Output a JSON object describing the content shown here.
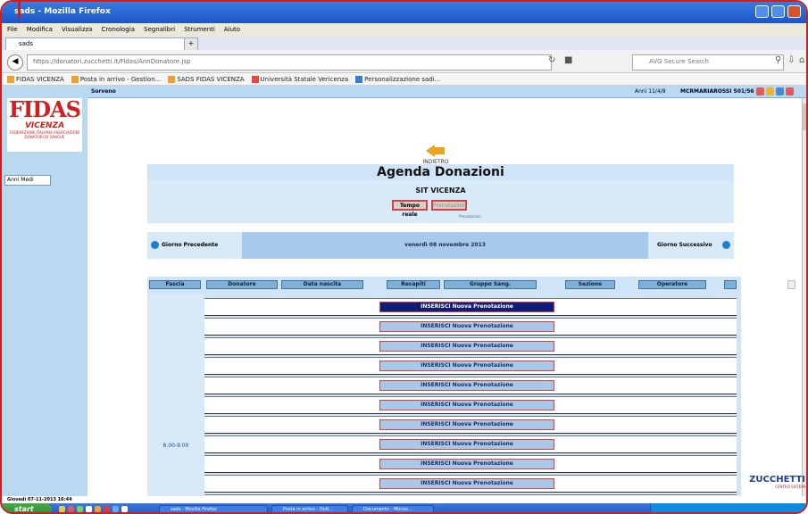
{
  "browser": {
    "title": "sads - Mozilla Firefox",
    "menu": [
      "File",
      "Modifica",
      "Visualizza",
      "Cronologia",
      "Segnalibri",
      "Strumenti",
      "Aiuto"
    ],
    "tab_label": "sads",
    "url": "https://donatori.zucchetti.it/Fidas/AnnDonatore.jsp",
    "search_placeholder": "AVG Secure Search",
    "bookmarks": [
      "FIDAS VICENZA",
      "Posta in arrivo - Gestion...",
      "SADS FIDAS VICENZA",
      "Università Statale Vericenza",
      "Personalizzazione sadi..."
    ]
  },
  "app": {
    "sidebar": {
      "logo_text": "FIDAS",
      "logo_sub": "VICENZA",
      "logo_caption": "FEDERAZIONE ITALIANA ASSOCIAZIONI DONATORI DI SANGUE",
      "nav_button": "Anni Medi"
    },
    "topbar": {
      "left_label": "Sorveno",
      "center_label": "Anni 11/4/8",
      "user_label": "MCRMARIAROSSI 501/56",
      "icon_colors": [
        "#e05a5a",
        "#f0b030",
        "#4a8ad0",
        "#e05a5a"
      ]
    },
    "back_label": "INDIETRO",
    "page_title": "Agenda Donazioni",
    "site_name": "SIT VICENZA",
    "toggle_active": "Tempo reale",
    "toggle_inactive": "Prenotazioni",
    "sub_note": "Prenotazioni",
    "day_nav": {
      "prev": "Giorno Precedente",
      "current": "venerdì 08 novembre 2013",
      "next": "Giorno Successivo"
    },
    "table": {
      "headers": [
        "Fascia",
        "Donatore",
        "Data nascita",
        "Recapiti",
        "Gruppo Sang.",
        "Sezione",
        "Operatore"
      ],
      "time_slot": "8.00-9.00",
      "row_button_label": "INSERISCI Nuova Prenotazione",
      "rows": 11,
      "selected_row": 0
    },
    "brand": {
      "name": "ZUCCHETTI",
      "tagline": "CENTRO SISTEMI"
    }
  },
  "status_bar": "Giovedì 07-11-2013 16:44",
  "taskbar": {
    "start": "start",
    "tasks": [
      "sads - Mozilla Firefox",
      "Posta in arrivo - Outl...",
      "Documento - Micros..."
    ]
  }
}
